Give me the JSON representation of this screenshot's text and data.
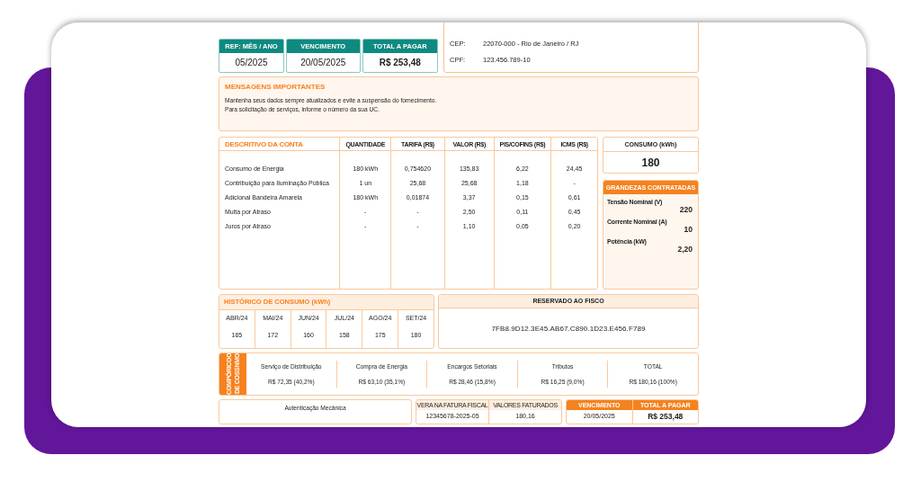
{
  "summary": {
    "columns": [
      {
        "header": "REF: MÊS / ANO",
        "value": "05/2025"
      },
      {
        "header": "VENCIMENTO",
        "value": "20/05/2025"
      },
      {
        "header": "TOTAL A PAGAR",
        "value": "R$ 253,48"
      }
    ]
  },
  "customer": {
    "fields": [
      {
        "label": "CEP:",
        "value": "22070-000 - Rio de Janeiro / RJ"
      },
      {
        "label": "CPF:",
        "value": "123.456.789-10"
      }
    ]
  },
  "messages": {
    "title": "MENSAGENS IMPORTANTES",
    "lines": [
      "Mantenha seus dados sempre atualizados e evite a suspensão do fornecimento.",
      "Para solicitação de serviços, informe o número da sua UC."
    ]
  },
  "account_table": {
    "columns": [
      "DESCRITIVO DA CONTA",
      "QUANTIDADE",
      "TARIFA (R$)",
      "VALOR (R$)",
      "PIS/COFINS (R$)",
      "ICMS (R$)"
    ],
    "rows": [
      [
        "Consumo de Energia",
        "180 kWh",
        "0,754620",
        "135,83",
        "6,22",
        "24,45"
      ],
      [
        "Contribuição para Iluminação Pública",
        "1 un",
        "25,68",
        "25,68",
        "1,18",
        "-"
      ],
      [
        "Adicional Bandeira Amarela",
        "180 kWh",
        "0,01874",
        "3,37",
        "0,15",
        "0,61"
      ],
      [
        "Multa por Atraso",
        "-",
        "-",
        "2,50",
        "0,11",
        "0,45"
      ],
      [
        "Juros por Atraso",
        "-",
        "-",
        "1,10",
        "0,05",
        "0,20"
      ]
    ]
  },
  "consumption": {
    "title": "CONSUMO (kWh)",
    "value": "180"
  },
  "contracted": {
    "title": "GRANDEZAS CONTRATADAS",
    "items": [
      {
        "label": "Tensão Nominal (V)",
        "value": "220"
      },
      {
        "label": "Corrente Nominal (A)",
        "value": "10"
      },
      {
        "label": "Potência (kW)",
        "value": "2,20"
      }
    ]
  },
  "history": {
    "title": "HISTÓRICO DE CONSUMO (kWh)",
    "months": [
      {
        "month": "ABR/24",
        "value": "165"
      },
      {
        "month": "MAI/24",
        "value": "172"
      },
      {
        "month": "JUN/24",
        "value": "160"
      },
      {
        "month": "JUL/24",
        "value": "158"
      },
      {
        "month": "AGO/24",
        "value": "175"
      },
      {
        "month": "SET/24",
        "value": "180"
      }
    ]
  },
  "fiscal": {
    "title": "RESERVADO AO FISCO",
    "code": "7FB8.9D12.3E45.AB67.C890.1D23.E456.F789"
  },
  "composition": {
    "title": "COMPÓRICOO DE COSSNMO",
    "items": [
      {
        "label": "Serviço de Distribuição",
        "value": "R$ 72,35 (40,2%)"
      },
      {
        "label": "Compra de Energia",
        "value": "R$ 63,10 (35,1%)"
      },
      {
        "label": "Encargos Setoriais",
        "value": "R$ 28,46 (15,8%)"
      },
      {
        "label": "Tributos",
        "value": "R$ 16,25 (9,0%)"
      },
      {
        "label": "TOTAL",
        "value": "R$ 180,16 (100%)"
      }
    ]
  },
  "footer": {
    "authentication": "Autenticação Mecânica",
    "invoice": [
      {
        "label": "VERA NA FATURA FISCAL",
        "value": "12345678-2025-05"
      },
      {
        "label": "VALORES FATURADOS",
        "value": "180,16"
      }
    ],
    "payment": [
      {
        "label": "VENCIMENTO",
        "value": "20/05/2025"
      },
      {
        "label": "TOTAL A PAGAR",
        "value": "R$ 253,48"
      }
    ]
  }
}
